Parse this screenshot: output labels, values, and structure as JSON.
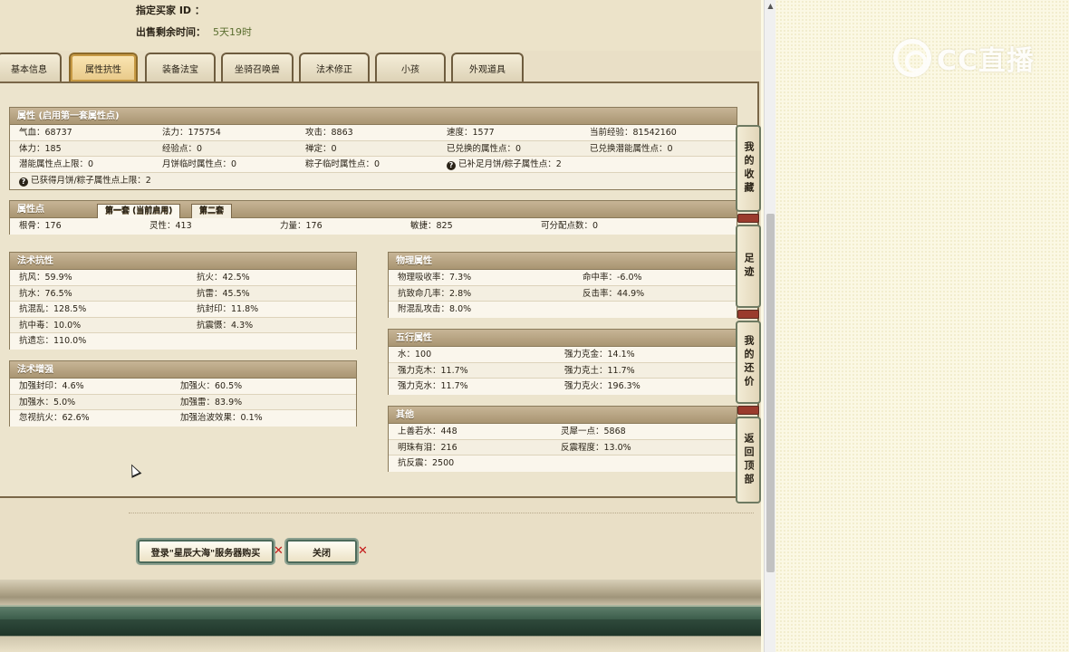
{
  "top_info": {
    "buyer_label": "指定买家 ID ：",
    "time_label": "出售剩余时间：",
    "time_value": "5天19时"
  },
  "tabs": [
    {
      "label": "基本信息"
    },
    {
      "label": "属性抗性"
    },
    {
      "label": "装备法宝"
    },
    {
      "label": "坐骑召唤兽"
    },
    {
      "label": "法术修正"
    },
    {
      "label": "小孩"
    },
    {
      "label": "外观道具"
    }
  ],
  "active_tab": "属性抗性",
  "attributes": {
    "title": "属性 (启用第一套属性点)",
    "rows": [
      [
        "气血：68737",
        "法力：175754",
        "攻击：8863",
        "速度：1577",
        "当前经验：81542160"
      ],
      [
        "体力：185",
        "经验点：0",
        "禅定：0",
        "已兑换的属性点：0",
        "已兑换潜能属性点：0"
      ],
      [
        "潜能属性点上限：0",
        "月饼临时属性点：0",
        "粽子临时属性点：0",
        "已补足月饼/粽子属性点：2"
      ],
      [
        "已获得月饼/粽子属性点上限：2"
      ]
    ]
  },
  "attr_points": {
    "title": "属性点",
    "subtab_first": "第一套 (当前启用)",
    "subtab_second": "第二套",
    "row": [
      "根骨：176",
      "灵性：413",
      "力量：176",
      "敏捷：825",
      "可分配点数：0"
    ]
  },
  "magic_resist": {
    "title": "法术抗性",
    "rows": [
      [
        "抗风：59.9%",
        "抗火：42.5%"
      ],
      [
        "抗水：76.5%",
        "抗雷：45.5%"
      ],
      [
        "抗混乱：128.5%",
        "抗封印：11.8%"
      ],
      [
        "抗中毒：10.0%",
        "抗震慑：4.3%"
      ],
      [
        "抗遗忘：110.0%"
      ]
    ]
  },
  "magic_boost": {
    "title": "法术增强",
    "rows": [
      [
        "加强封印：4.6%",
        "加强火：60.5%"
      ],
      [
        "加强水：5.0%",
        "加强雷：83.9%"
      ],
      [
        "忽视抗火：62.6%",
        "加强治波效果：0.1%"
      ]
    ]
  },
  "physical": {
    "title": "物理属性",
    "rows": [
      [
        "物理吸收率：7.3%",
        "命中率：-6.0%"
      ],
      [
        "抗致命几率：2.8%",
        "反击率：44.9%"
      ],
      [
        "附混乱攻击：8.0%"
      ]
    ]
  },
  "five_elements": {
    "title": "五行属性",
    "rows": [
      [
        "水：100",
        "强力克金：14.1%"
      ],
      [
        "强力克木：11.7%",
        "强力克土：11.7%"
      ],
      [
        "强力克水：11.7%",
        "强力克火：196.3%"
      ]
    ]
  },
  "other": {
    "title": "其他",
    "rows": [
      [
        "上善若水：448",
        "灵犀一点：5868"
      ],
      [
        "明珠有泪：216",
        "反震程度：13.0%"
      ],
      [
        "抗反震：2500"
      ]
    ]
  },
  "side_nav": [
    {
      "label": "我的收藏"
    },
    {
      "label": "足迹"
    },
    {
      "label": "我的还价"
    },
    {
      "label": "返回顶部"
    }
  ],
  "buttons": {
    "login": "登录\"星辰大海\"服务器购买",
    "close": "关闭"
  },
  "watermark": {
    "text": "CC直播"
  }
}
